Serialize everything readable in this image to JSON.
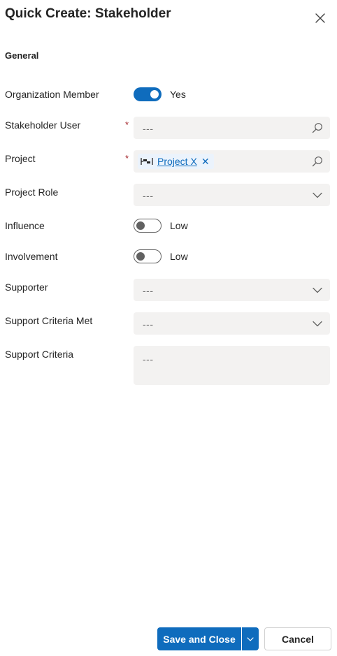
{
  "dialog": {
    "title": "Quick Create: Stakeholder"
  },
  "section": {
    "title": "General"
  },
  "fields": {
    "organization_member": {
      "label": "Organization Member",
      "value": "Yes",
      "on": true
    },
    "stakeholder_user": {
      "label": "Stakeholder User",
      "required_mark": "*",
      "placeholder": "---"
    },
    "project": {
      "label": "Project",
      "required_mark": "*",
      "value": "Project X",
      "remove_glyph": "✕"
    },
    "project_role": {
      "label": "Project Role",
      "placeholder": "---"
    },
    "influence": {
      "label": "Influence",
      "value": "Low",
      "on": false
    },
    "involvement": {
      "label": "Involvement",
      "value": "Low",
      "on": false
    },
    "supporter": {
      "label": "Supporter",
      "placeholder": "---"
    },
    "support_criteria_met": {
      "label": "Support Criteria Met",
      "placeholder": "---"
    },
    "support_criteria": {
      "label": "Support Criteria",
      "placeholder": "---"
    }
  },
  "footer": {
    "save_label": "Save and Close",
    "cancel_label": "Cancel"
  },
  "icons": {
    "close": "close-icon",
    "search": "search-icon",
    "chevron": "chevron-down-icon",
    "project_entity": "project-entity-icon"
  },
  "colors": {
    "accent": "#0f6cbd",
    "required": "#a4262c",
    "field_bg": "#f3f2f1",
    "tag_bg": "#ebf3fc"
  }
}
